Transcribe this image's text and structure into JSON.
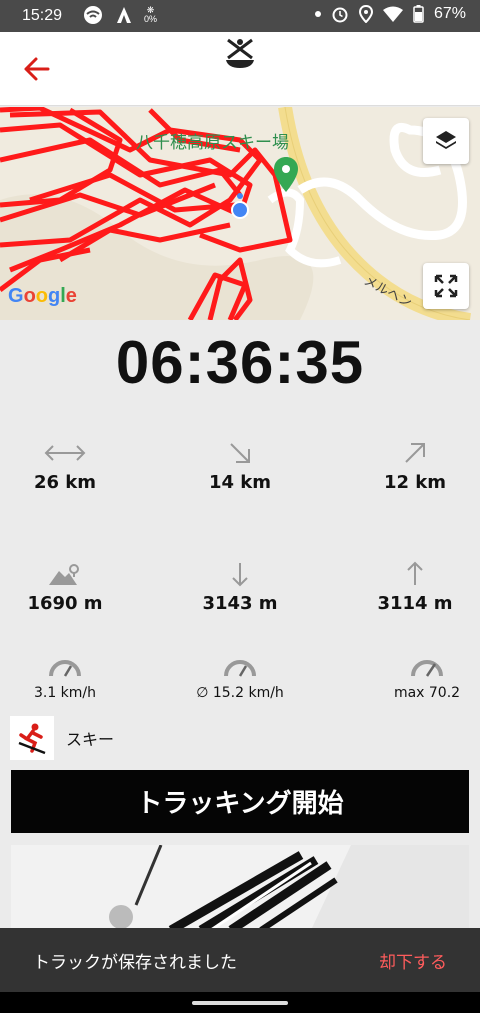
{
  "status_bar": {
    "time": "15:29",
    "data_badge": "0%",
    "battery": "67%"
  },
  "header": {
    "back_icon": "arrow-left-icon",
    "logo_icon": "skier-logo-icon"
  },
  "map": {
    "place_label": "八千穂高原スキー場",
    "road_label": "メルヘン",
    "attribution": "Google",
    "layers_icon": "layers-icon",
    "fullscreen_icon": "fullscreen-icon"
  },
  "timer": "06:36:35",
  "stats": {
    "distance": {
      "icon": "horizontal-arrows-icon",
      "value": "26 km"
    },
    "downhill_distance": {
      "icon": "arrow-down-right-icon",
      "value": "14 km"
    },
    "uphill_distance": {
      "icon": "arrow-up-right-icon",
      "value": "12 km"
    },
    "altitude": {
      "icon": "mountain-pin-icon",
      "value": "1690 m"
    },
    "descent": {
      "icon": "arrow-down-icon",
      "value": "3143 m"
    },
    "ascent": {
      "icon": "arrow-up-icon",
      "value": "3114 m"
    },
    "current_speed": {
      "icon": "speedometer-icon",
      "value": "3.1 km/h"
    },
    "avg_speed": {
      "icon": "speedometer-icon",
      "value": "∅ 15.2 km/h"
    },
    "max_speed": {
      "icon": "speedometer-icon",
      "value": "max 70.2"
    }
  },
  "activity": {
    "icon": "skier-icon",
    "label": "スキー"
  },
  "start_button": "トラッキング開始",
  "snackbar": {
    "message": "トラックが保存されました",
    "action": "却下する"
  },
  "colors": {
    "accent": "#d91e18",
    "track": "#ff1a1a",
    "button_bg": "#050505",
    "snackbar_action": "#ff5c5c"
  }
}
